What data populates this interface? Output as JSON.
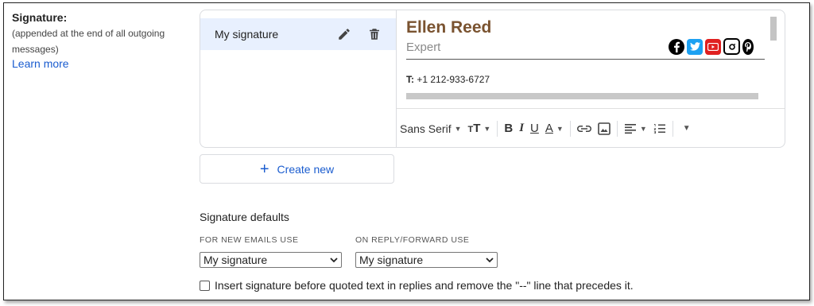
{
  "signature_section": {
    "title": "Signature:",
    "description": "(appended at the end of all outgoing messages)",
    "learn_more": "Learn more"
  },
  "signature_list": {
    "items": [
      {
        "label": "My signature"
      }
    ]
  },
  "preview": {
    "name": "Ellen Reed",
    "role": "Expert",
    "phone_label": "T:",
    "phone": "+1 212-933-6727",
    "socials": [
      "facebook-icon",
      "twitter-icon",
      "youtube-icon",
      "instagram-icon",
      "pinterest-icon"
    ]
  },
  "toolbar": {
    "font": "Sans Serif",
    "items": [
      "font-size",
      "bold",
      "italic",
      "underline",
      "text-color",
      "link",
      "image",
      "align",
      "numbered-list",
      "more"
    ],
    "bold": "B",
    "italic": "I",
    "underline": "U",
    "text_color": "A"
  },
  "create_new": "Create new",
  "defaults": {
    "title": "Signature defaults",
    "new_emails_label": "FOR NEW EMAILS USE",
    "new_emails_value": "My signature",
    "reply_label": "ON REPLY/FORWARD USE",
    "reply_value": "My signature"
  },
  "insert_before": {
    "checked": false,
    "label": "Insert signature before quoted text in replies and remove the \"--\" line that precedes it."
  },
  "colors": {
    "accent": "#1a5ccf",
    "selected_bg": "#e8f0fe",
    "name_color": "#7a5330"
  }
}
